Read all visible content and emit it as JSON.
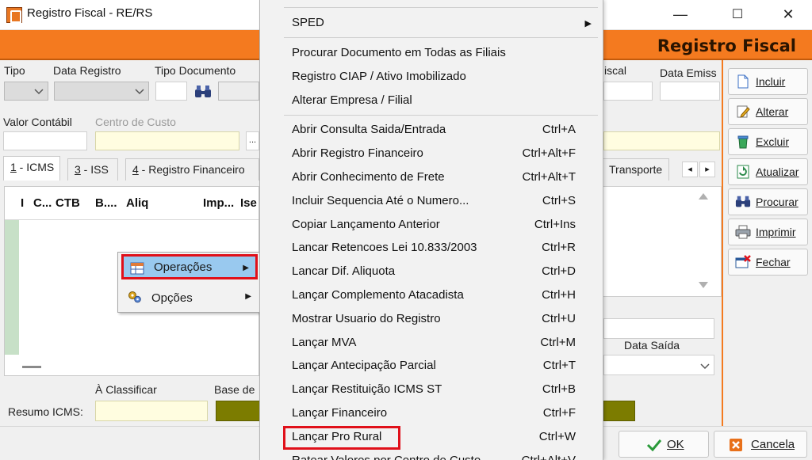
{
  "window": {
    "title": "Registro Fiscal - RE/RS",
    "minimize": "—",
    "maximize": "☐",
    "close": "✕"
  },
  "header": {
    "title": "Registro Fiscal"
  },
  "form": {
    "tipo_label": "Tipo",
    "data_registro_label": "Data Registro",
    "tipo_documento_label": "Tipo Documento",
    "fiscal_label": "iscal",
    "data_emissao_label": "Data Emiss",
    "valor_contabil_label": "Valor Contábil",
    "centro_custo_label": "Centro de Custo",
    "ellipsis_button": "...",
    "data_saida_label": "Data Saída",
    "a_classificar_label": "À Classificar",
    "base_de_label": "Base de",
    "resumo_icms_label": "Resumo ICMS:"
  },
  "tabs": [
    {
      "key": "1",
      "label": " - ICMS"
    },
    {
      "key": "3",
      "label": " - ISS"
    },
    {
      "key": "4",
      "label": " - Registro Financeiro"
    },
    {
      "key": "",
      "label": "Transporte"
    }
  ],
  "tab_scroll": {
    "left": "◂",
    "right": "▸"
  },
  "grid": {
    "columns": [
      "I",
      "C...",
      "CTB",
      "B....",
      "Aliq",
      "Imp...",
      "Ise"
    ]
  },
  "context_menu": {
    "items": [
      {
        "label": "Operações",
        "icon": "table-icon",
        "highlighted": true
      },
      {
        "label": "Opções",
        "icon": "gears-icon",
        "highlighted": false
      }
    ],
    "arrow": "▶"
  },
  "submenu": {
    "items": [
      {
        "label": "SPED",
        "shortcut": "",
        "has_arrow": true
      },
      {
        "sep": true
      },
      {
        "label": "Procurar Documento em Todas as Filiais",
        "shortcut": ""
      },
      {
        "label": "Registro CIAP / Ativo Imobilizado",
        "shortcut": ""
      },
      {
        "label": "Alterar Empresa / Filial",
        "shortcut": ""
      },
      {
        "sep": true
      },
      {
        "label": "Abrir Consulta Saida/Entrada",
        "shortcut": "Ctrl+A"
      },
      {
        "label": "Abrir Registro Financeiro",
        "shortcut": "Ctrl+Alt+F"
      },
      {
        "label": "Abrir Conhecimento de Frete",
        "shortcut": "Ctrl+Alt+T"
      },
      {
        "label": "Incluir Sequencia  Até o Numero...",
        "shortcut": "Ctrl+S"
      },
      {
        "label": "Copiar Lançamento Anterior",
        "shortcut": "Ctrl+Ins"
      },
      {
        "label": "Lancar Retencoes Lei 10.833/2003",
        "shortcut": "Ctrl+R"
      },
      {
        "label": "Lancar Dif. Aliquota",
        "shortcut": "Ctrl+D"
      },
      {
        "label": "Lançar Complemento Atacadista",
        "shortcut": "Ctrl+H"
      },
      {
        "label": "Mostrar Usuario do Registro",
        "shortcut": "Ctrl+U"
      },
      {
        "label": "Lançar MVA",
        "shortcut": "Ctrl+M"
      },
      {
        "label": "Lançar Antecipação Parcial",
        "shortcut": "Ctrl+T"
      },
      {
        "label": "Lançar Restituição ICMS ST",
        "shortcut": "Ctrl+B"
      },
      {
        "label": "Lançar Financeiro",
        "shortcut": "Ctrl+F"
      },
      {
        "label": "Lançar Pro Rural",
        "shortcut": "Ctrl+W",
        "highlighted": true
      },
      {
        "label": "Ratear Valores por Centro de Custo",
        "shortcut": "Ctrl+Alt+V"
      }
    ]
  },
  "side_buttons": [
    {
      "label": "Incluir",
      "icon": "document-icon"
    },
    {
      "label": "Alterar",
      "icon": "pencil-icon"
    },
    {
      "label": "Excluir",
      "icon": "trash-icon"
    },
    {
      "label": "Atualizar",
      "icon": "refresh-icon"
    },
    {
      "label": "Procurar",
      "icon": "binoculars-icon"
    },
    {
      "label": "Imprimir",
      "icon": "printer-icon"
    },
    {
      "label": "Fechar",
      "icon": "close-window-icon"
    }
  ],
  "bottom_buttons": {
    "ok": "OK",
    "cancel": "Cancela"
  },
  "colors": {
    "accent_orange": "#f47a1f",
    "highlight_red": "#e0101a",
    "menu_highlight": "#99c9ef",
    "olive": "#7c7c00"
  }
}
